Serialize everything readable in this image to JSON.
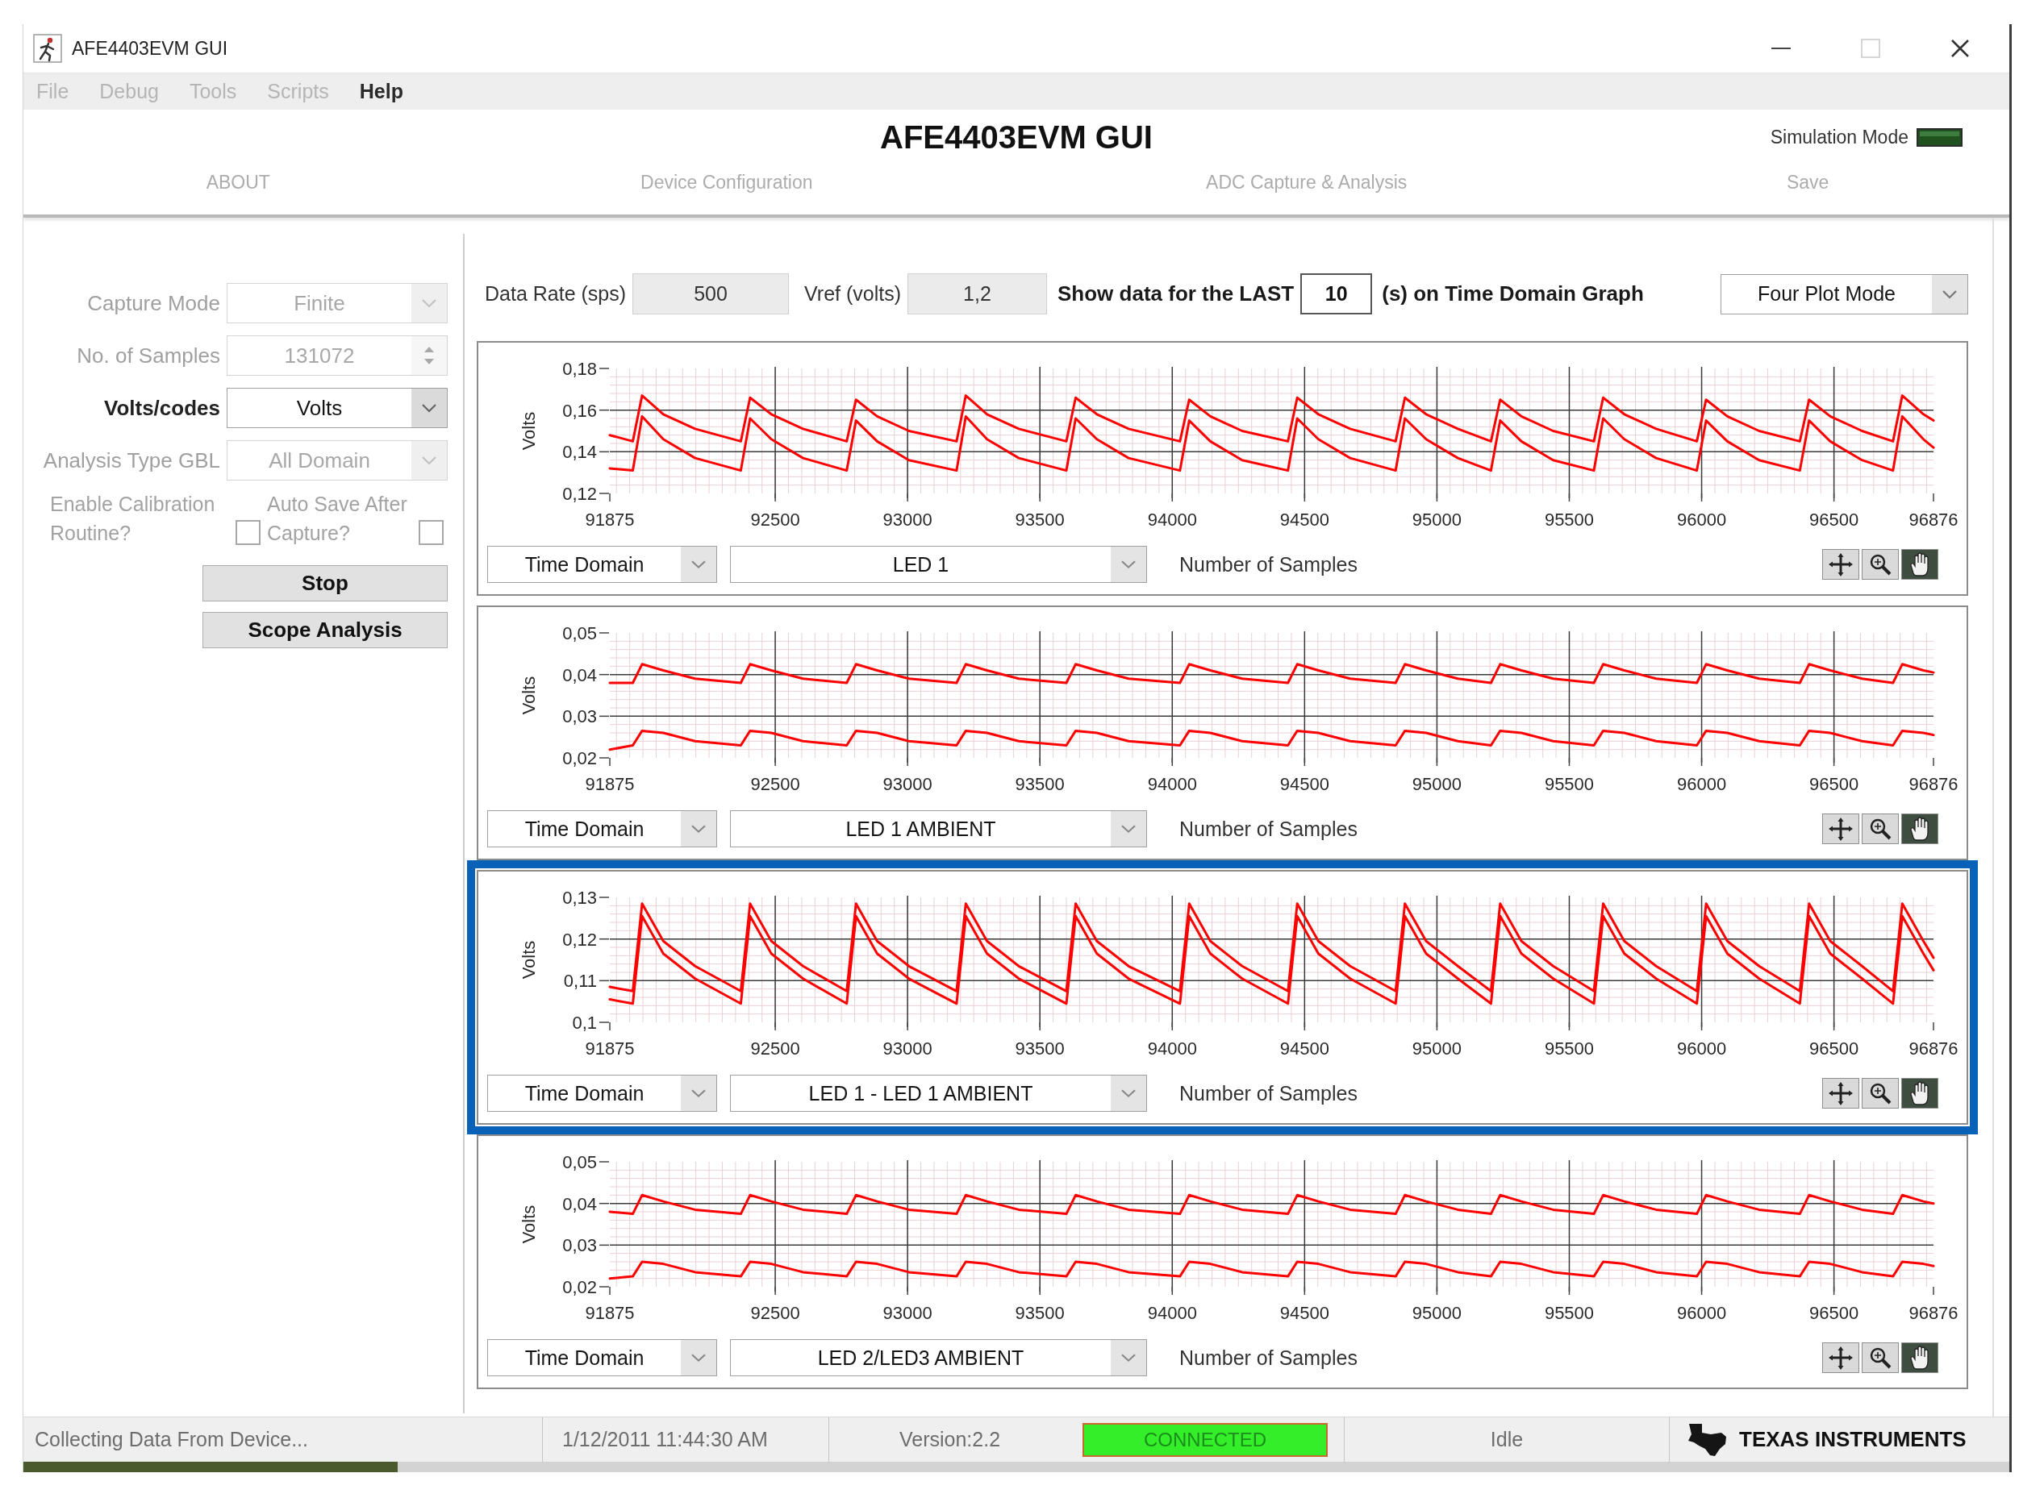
{
  "window": {
    "title": "AFE4403EVM GUI",
    "maximize_disabled": true
  },
  "menu": [
    {
      "label": "File",
      "disabled": true
    },
    {
      "label": "Debug",
      "disabled": true
    },
    {
      "label": "Tools",
      "disabled": true
    },
    {
      "label": "Scripts",
      "disabled": true
    },
    {
      "label": "Help",
      "disabled": false
    }
  ],
  "header": {
    "title": "AFE4403EVM GUI",
    "simulation": {
      "label": "Simulation Mode",
      "on": false
    }
  },
  "tabs": [
    {
      "label": "ABOUT",
      "disabled": true
    },
    {
      "label": "Device Configuration",
      "disabled": true
    },
    {
      "label": "ADC Capture & Analysis",
      "disabled": true
    },
    {
      "label": "Save",
      "disabled": true
    }
  ],
  "settings": [
    {
      "kind": "dropdown",
      "label": "Capture Mode",
      "value": "Finite",
      "disabled": true
    },
    {
      "kind": "spinner",
      "label": "No. of Samples",
      "value": "131072",
      "disabled": true
    },
    {
      "kind": "dropdown",
      "label": "Volts/codes",
      "value": "Volts",
      "disabled": false
    },
    {
      "kind": "dropdown",
      "label": "Analysis Type GBL",
      "value": "All Domain",
      "disabled": true
    }
  ],
  "options": [
    {
      "label": "Enable Calibration Routine?",
      "checked": false,
      "disabled": true
    },
    {
      "label": "Auto Save After Capture?",
      "checked": false,
      "disabled": true
    }
  ],
  "actions": [
    "Stop",
    "Scope Analysis"
  ],
  "acquisition": {
    "fields": [
      {
        "label": "Data Rate (sps)",
        "value": "500",
        "readonly": true
      },
      {
        "label": "Vref (volts)",
        "value": "1,2",
        "readonly": true
      }
    ],
    "window": {
      "prefix": "Show data for the LAST",
      "value": "10",
      "suffix": "(s) on Time Domain Graph",
      "readonly": false
    },
    "plot_mode": "Four Plot Mode"
  },
  "plots": [
    {
      "domain": "Time Domain",
      "channel": "LED 1",
      "highlighted": false,
      "tools": [
        {
          "kind": "cursor",
          "selected": false
        },
        {
          "kind": "zoom",
          "selected": false
        },
        {
          "kind": "pan",
          "selected": true
        }
      ],
      "chart_data": {
        "type": "line",
        "xlabel": "Number of Samples",
        "ylabel": "Volts",
        "grid": true,
        "xlim": [
          91875,
          96876
        ],
        "ylim": [
          0.12,
          0.18
        ],
        "xticks": [
          91875,
          92500,
          93000,
          93500,
          94000,
          94500,
          95000,
          95500,
          96000,
          96500,
          96876
        ],
        "yticks": [
          {
            "value": 0.12,
            "label": "0,12"
          },
          {
            "value": 0.14,
            "label": "0,14"
          },
          {
            "value": 0.16,
            "label": "0,16"
          },
          {
            "value": 0.18,
            "label": "0,18"
          }
        ],
        "x": [
          91875,
          91962,
          91997,
          92077,
          92197,
          92370,
          92405,
          92485,
          92605,
          92770,
          92805,
          92885,
          93005,
          93185,
          93220,
          93300,
          93420,
          93600,
          93635,
          93715,
          93835,
          94029,
          94064,
          94144,
          94264,
          94437,
          94472,
          94552,
          94672,
          94844,
          94879,
          94959,
          95079,
          95204,
          95239,
          95319,
          95439,
          95593,
          95628,
          95708,
          95828,
          95982,
          96017,
          96097,
          96217,
          96371,
          96406,
          96486,
          96606,
          96723,
          96758,
          96838,
          96876
        ],
        "series": [
          {
            "color": "#ff0000",
            "values": [
              0.148,
              0.145,
              0.167,
              0.158,
              0.151,
              0.145,
              0.166,
              0.158,
              0.151,
              0.145,
              0.165,
              0.157,
              0.15,
              0.145,
              0.167,
              0.158,
              0.151,
              0.145,
              0.166,
              0.158,
              0.151,
              0.145,
              0.165,
              0.157,
              0.15,
              0.145,
              0.166,
              0.158,
              0.151,
              0.145,
              0.166,
              0.158,
              0.151,
              0.145,
              0.165,
              0.157,
              0.15,
              0.145,
              0.166,
              0.158,
              0.151,
              0.145,
              0.165,
              0.157,
              0.15,
              0.145,
              0.165,
              0.157,
              0.15,
              0.145,
              0.167,
              0.158,
              0.155
            ]
          },
          {
            "color": "#ff0000",
            "values": [
              0.132,
              0.131,
              0.157,
              0.146,
              0.137,
              0.131,
              0.156,
              0.146,
              0.137,
              0.131,
              0.155,
              0.145,
              0.136,
              0.131,
              0.157,
              0.146,
              0.137,
              0.131,
              0.156,
              0.146,
              0.137,
              0.131,
              0.155,
              0.145,
              0.136,
              0.131,
              0.156,
              0.146,
              0.137,
              0.131,
              0.156,
              0.146,
              0.137,
              0.131,
              0.155,
              0.145,
              0.136,
              0.131,
              0.156,
              0.146,
              0.137,
              0.131,
              0.155,
              0.145,
              0.136,
              0.131,
              0.155,
              0.145,
              0.136,
              0.131,
              0.157,
              0.146,
              0.142
            ]
          }
        ]
      }
    },
    {
      "domain": "Time Domain",
      "channel": "LED 1 AMBIENT",
      "highlighted": false,
      "tools": [
        {
          "kind": "cursor",
          "selected": false
        },
        {
          "kind": "zoom",
          "selected": false
        },
        {
          "kind": "pan",
          "selected": true
        }
      ],
      "chart_data": {
        "type": "line",
        "xlabel": "Number of Samples",
        "ylabel": "Volts",
        "grid": true,
        "xlim": [
          91875,
          96876
        ],
        "ylim": [
          0.02,
          0.05
        ],
        "xticks": [
          91875,
          92500,
          93000,
          93500,
          94000,
          94500,
          95000,
          95500,
          96000,
          96500,
          96876
        ],
        "yticks": [
          {
            "value": 0.02,
            "label": "0,02"
          },
          {
            "value": 0.03,
            "label": "0,03"
          },
          {
            "value": 0.04,
            "label": "0,04"
          },
          {
            "value": 0.05,
            "label": "0,05"
          }
        ],
        "x": [
          91875,
          91962,
          91997,
          92077,
          92197,
          92370,
          92405,
          92485,
          92605,
          92770,
          92805,
          92885,
          93005,
          93185,
          93220,
          93300,
          93420,
          93600,
          93635,
          93715,
          93835,
          94029,
          94064,
          94144,
          94264,
          94437,
          94472,
          94552,
          94672,
          94844,
          94879,
          94959,
          95079,
          95204,
          95239,
          95319,
          95439,
          95593,
          95628,
          95708,
          95828,
          95982,
          96017,
          96097,
          96217,
          96371,
          96406,
          96486,
          96606,
          96723,
          96758,
          96838,
          96876
        ],
        "series": [
          {
            "color": "#ff0000",
            "values": [
              0.038,
              0.038,
              0.0425,
              0.041,
              0.039,
              0.038,
              0.0425,
              0.041,
              0.039,
              0.038,
              0.0425,
              0.041,
              0.039,
              0.038,
              0.0425,
              0.041,
              0.039,
              0.038,
              0.0425,
              0.041,
              0.039,
              0.038,
              0.0425,
              0.041,
              0.039,
              0.038,
              0.0425,
              0.041,
              0.039,
              0.038,
              0.0425,
              0.041,
              0.039,
              0.038,
              0.0425,
              0.041,
              0.039,
              0.038,
              0.0425,
              0.041,
              0.039,
              0.038,
              0.0425,
              0.041,
              0.039,
              0.038,
              0.0425,
              0.041,
              0.039,
              0.038,
              0.0425,
              0.041,
              0.0405
            ]
          },
          {
            "color": "#ff0000",
            "values": [
              0.022,
              0.023,
              0.0265,
              0.026,
              0.024,
              0.023,
              0.0265,
              0.026,
              0.024,
              0.023,
              0.0265,
              0.026,
              0.024,
              0.023,
              0.0265,
              0.026,
              0.024,
              0.023,
              0.0265,
              0.026,
              0.024,
              0.023,
              0.0265,
              0.026,
              0.024,
              0.023,
              0.0265,
              0.026,
              0.024,
              0.023,
              0.0265,
              0.026,
              0.024,
              0.023,
              0.0265,
              0.026,
              0.024,
              0.023,
              0.0265,
              0.026,
              0.024,
              0.023,
              0.0265,
              0.026,
              0.024,
              0.023,
              0.0265,
              0.026,
              0.024,
              0.023,
              0.0265,
              0.026,
              0.0255
            ]
          }
        ]
      }
    },
    {
      "domain": "Time Domain",
      "channel": "LED 1 - LED 1 AMBIENT",
      "highlighted": true,
      "tools": [
        {
          "kind": "cursor",
          "selected": false
        },
        {
          "kind": "zoom",
          "selected": false
        },
        {
          "kind": "pan",
          "selected": true
        }
      ],
      "chart_data": {
        "type": "line",
        "xlabel": "Number of Samples",
        "ylabel": "Volts",
        "grid": true,
        "xlim": [
          91875,
          96876
        ],
        "ylim": [
          0.1,
          0.13
        ],
        "xticks": [
          91875,
          92500,
          93000,
          93500,
          94000,
          94500,
          95000,
          95500,
          96000,
          96500,
          96876
        ],
        "yticks": [
          {
            "value": 0.1,
            "label": "0,1"
          },
          {
            "value": 0.11,
            "label": "0,11"
          },
          {
            "value": 0.12,
            "label": "0,12"
          },
          {
            "value": 0.13,
            "label": "0,13"
          }
        ],
        "x": [
          91875,
          91962,
          91997,
          92077,
          92197,
          92370,
          92405,
          92485,
          92605,
          92770,
          92805,
          92885,
          93005,
          93185,
          93220,
          93300,
          93420,
          93600,
          93635,
          93715,
          93835,
          94029,
          94064,
          94144,
          94264,
          94437,
          94472,
          94552,
          94672,
          94844,
          94879,
          94959,
          95079,
          95204,
          95239,
          95319,
          95439,
          95593,
          95628,
          95708,
          95828,
          95982,
          96017,
          96097,
          96217,
          96371,
          96406,
          96486,
          96606,
          96723,
          96758,
          96838,
          96876
        ],
        "series": [
          {
            "color": "#ff0000",
            "values": [
              0.1085,
              0.1075,
              0.1285,
              0.1195,
              0.1135,
              0.1075,
              0.1285,
              0.1195,
              0.1135,
              0.1075,
              0.1285,
              0.1195,
              0.1135,
              0.1075,
              0.1285,
              0.1195,
              0.1135,
              0.1075,
              0.1285,
              0.1195,
              0.1135,
              0.1075,
              0.1285,
              0.1195,
              0.1135,
              0.1075,
              0.1285,
              0.1195,
              0.1135,
              0.1075,
              0.1285,
              0.1195,
              0.1135,
              0.1075,
              0.1285,
              0.1195,
              0.1135,
              0.1075,
              0.1285,
              0.1195,
              0.1135,
              0.1075,
              0.1285,
              0.1195,
              0.1135,
              0.1075,
              0.1285,
              0.1195,
              0.1135,
              0.1075,
              0.1285,
              0.1195,
              0.1155
            ]
          },
          {
            "color": "#ff0000",
            "values": [
              0.1055,
              0.1045,
              0.1255,
              0.1165,
              0.1105,
              0.1045,
              0.1255,
              0.1165,
              0.1105,
              0.1045,
              0.1255,
              0.1165,
              0.1105,
              0.1045,
              0.1255,
              0.1165,
              0.1105,
              0.1045,
              0.1255,
              0.1165,
              0.1105,
              0.1045,
              0.1255,
              0.1165,
              0.1105,
              0.1045,
              0.1255,
              0.1165,
              0.1105,
              0.1045,
              0.1255,
              0.1165,
              0.1105,
              0.1045,
              0.1255,
              0.1165,
              0.1105,
              0.1045,
              0.1255,
              0.1165,
              0.1105,
              0.1045,
              0.1255,
              0.1165,
              0.1105,
              0.1045,
              0.1255,
              0.1165,
              0.1105,
              0.1045,
              0.1255,
              0.1165,
              0.1125
            ]
          }
        ]
      }
    },
    {
      "domain": "Time Domain",
      "channel": "LED 2/LED3 AMBIENT",
      "highlighted": false,
      "tools": [
        {
          "kind": "cursor",
          "selected": false
        },
        {
          "kind": "zoom",
          "selected": false
        },
        {
          "kind": "pan",
          "selected": true
        }
      ],
      "chart_data": {
        "type": "line",
        "xlabel": "Number of Samples",
        "ylabel": "Volts",
        "grid": true,
        "xlim": [
          91875,
          96876
        ],
        "ylim": [
          0.02,
          0.05
        ],
        "xticks": [
          91875,
          92500,
          93000,
          93500,
          94000,
          94500,
          95000,
          95500,
          96000,
          96500,
          96876
        ],
        "yticks": [
          {
            "value": 0.02,
            "label": "0,02"
          },
          {
            "value": 0.03,
            "label": "0,03"
          },
          {
            "value": 0.04,
            "label": "0,04"
          },
          {
            "value": 0.05,
            "label": "0,05"
          }
        ],
        "x": [
          91875,
          91962,
          91997,
          92077,
          92197,
          92370,
          92405,
          92485,
          92605,
          92770,
          92805,
          92885,
          93005,
          93185,
          93220,
          93300,
          93420,
          93600,
          93635,
          93715,
          93835,
          94029,
          94064,
          94144,
          94264,
          94437,
          94472,
          94552,
          94672,
          94844,
          94879,
          94959,
          95079,
          95204,
          95239,
          95319,
          95439,
          95593,
          95628,
          95708,
          95828,
          95982,
          96017,
          96097,
          96217,
          96371,
          96406,
          96486,
          96606,
          96723,
          96758,
          96838,
          96876
        ],
        "series": [
          {
            "color": "#ff0000",
            "values": [
              0.038,
              0.0375,
              0.042,
              0.0405,
              0.0385,
              0.0375,
              0.042,
              0.0405,
              0.0385,
              0.0375,
              0.042,
              0.0405,
              0.0385,
              0.0375,
              0.042,
              0.0405,
              0.0385,
              0.0375,
              0.042,
              0.0405,
              0.0385,
              0.0375,
              0.042,
              0.0405,
              0.0385,
              0.0375,
              0.042,
              0.0405,
              0.0385,
              0.0375,
              0.042,
              0.0405,
              0.0385,
              0.0375,
              0.042,
              0.0405,
              0.0385,
              0.0375,
              0.042,
              0.0405,
              0.0385,
              0.0375,
              0.042,
              0.0405,
              0.0385,
              0.0375,
              0.042,
              0.0405,
              0.0385,
              0.0375,
              0.042,
              0.0405,
              0.04
            ]
          },
          {
            "color": "#ff0000",
            "values": [
              0.022,
              0.0225,
              0.026,
              0.0255,
              0.0235,
              0.0225,
              0.026,
              0.0255,
              0.0235,
              0.0225,
              0.026,
              0.0255,
              0.0235,
              0.0225,
              0.026,
              0.0255,
              0.0235,
              0.0225,
              0.026,
              0.0255,
              0.0235,
              0.0225,
              0.026,
              0.0255,
              0.0235,
              0.0225,
              0.026,
              0.0255,
              0.0235,
              0.0225,
              0.026,
              0.0255,
              0.0235,
              0.0225,
              0.026,
              0.0255,
              0.0235,
              0.0225,
              0.026,
              0.0255,
              0.0235,
              0.0225,
              0.026,
              0.0255,
              0.0235,
              0.0225,
              0.026,
              0.0255,
              0.0235,
              0.0225,
              0.026,
              0.0255,
              0.025
            ]
          }
        ]
      }
    }
  ],
  "status_bar": {
    "message": "Collecting Data From Device...",
    "timestamp": "1/12/2011 11:44:30 AM",
    "version": "Version:2.2",
    "connection": {
      "label": "CONNECTED",
      "connected": true
    },
    "state": "Idle",
    "brand": "TEXAS INSTRUMENTS"
  }
}
